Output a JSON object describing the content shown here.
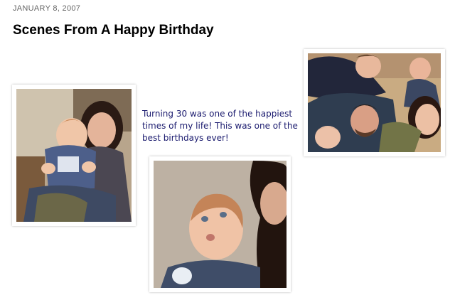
{
  "post": {
    "date": "JANUARY 8, 2007",
    "title": "Scenes From A Happy Birthday",
    "caption": "Turning 30 was one of the happiest times of my life! This was one of the best birthdays ever!"
  },
  "colors": {
    "caption_text": "#1a1a6e",
    "date_text": "#666666",
    "title_text": "#000000"
  }
}
